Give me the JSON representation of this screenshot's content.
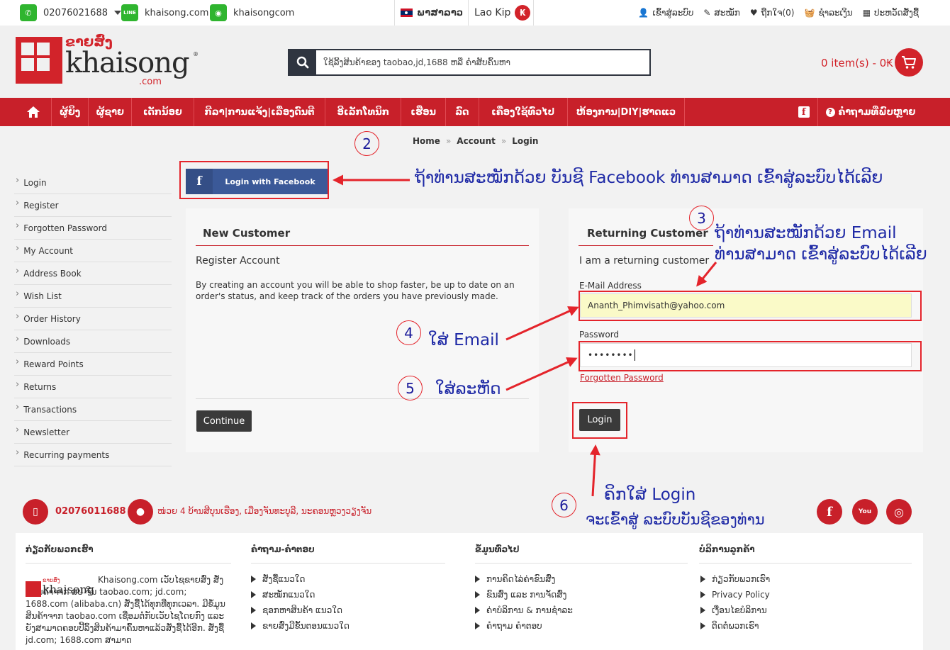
{
  "topbar": {
    "phone": "02076021688",
    "line_label": "LINE",
    "line_site": "khaisong.com",
    "wechat_site": "khaisongcom",
    "language": "ພາສາລາວ",
    "currency": "Lao Kip",
    "currency_symbol": "₭",
    "links": [
      "ເຂົ້າສູ່ລະບົບ",
      "ສະໝັກ",
      "ຖືກໃຈ(0)",
      "ຊຳລະເງິນ",
      "ປະຫວັດສັ່ງຊື້"
    ]
  },
  "header": {
    "logo_lao": "ຂາຍສົ່ງ",
    "logo_main": "khaisong",
    "logo_com": ".com",
    "logo_reg": "®",
    "search_placeholder": "ໃຊ້ລີ້ງສິນຄ້າຂອງ taobao,jd,1688 ຫລື ຄຳສັບຄົ້ນຫາ",
    "cart_text": "0 item(s) - 0₭"
  },
  "nav": {
    "items": [
      "ຜູ້ຍິງ",
      "ຜູ້ຊາຍ",
      "ເດັກນ້ອຍ",
      "ກີລາ|ການແຈ້ງ|ເລື່ອງດົນຕີ",
      "ອີເລັກໂທນິກ",
      "ເຮືອນ",
      "ລົດ",
      "ເຄື່ອງໃຊ້ທົ່ວໄປ",
      "ຫ້ອງການ|DIY|ຮາດແວ"
    ],
    "faq": "ຄຳຖາມທີ່ພົບຫຼາຍ"
  },
  "breadcrumb": [
    "Home",
    "Account",
    "Login"
  ],
  "sidebar": {
    "items": [
      "Login",
      "Register",
      "Forgotten Password",
      "My Account",
      "Address Book",
      "Wish List",
      "Order History",
      "Downloads",
      "Reward Points",
      "Returns",
      "Transactions",
      "Newsletter",
      "Recurring payments"
    ]
  },
  "facebook_login": {
    "letter": "f",
    "label": "Login with Facebook"
  },
  "new_customer": {
    "title": "New Customer",
    "subtitle": "Register Account",
    "desc": "By creating an account you will be able to shop faster, be up to date on an order's status, and keep track of the orders you have previously made.",
    "button": "Continue"
  },
  "returning_customer": {
    "title": "Returning Customer",
    "subtitle": "I am a returning customer",
    "email_label": "E-Mail Address",
    "email_value": "Ananth_Phimvisath@yahoo.com",
    "password_label": "Password",
    "password_value": "••••••••",
    "forgot": "Forgotten Password",
    "button": "Login"
  },
  "annotations": {
    "n2": "2",
    "n3": "3",
    "n4": "4",
    "n5": "5",
    "n6": "6",
    "fb_note": "ຖ້າທ່ານສະໝັກດ້ວຍ ບັນຊີ Facebook ທ່ານສາມາດ ເຂົ້າສູ່ລະບົບໄດ້ເລີຍ",
    "email_note_1": "ຖ້າທ່ານສະໝັກດ້ວຍ Email",
    "email_note_2": "ທ່ານສາມາດ ເຂົ້າສູ່ລະບົບໄດ້ເລີຍ",
    "email_step": "ໃສ່ Email",
    "pass_step": "ໃສ່ລະຫັດ",
    "login_step_1": "ຄິກໃສ່ Login",
    "login_step_2": "ຈະເຂົ້າສູ່ ລະບົບບັນຊີຂອງທ່ານ"
  },
  "footer": {
    "phone": "02076011688",
    "address": "ໜ່ວຍ 4 ບ້ານສີບຸນເຮືອງ, ເມືອງຈັນທະບູລີ, ນະຄອນຫຼວງວຽງຈັນ",
    "social": [
      "f",
      "You",
      "◎"
    ],
    "col1_title": "ກ່ຽວກັບພວກເຮົາ",
    "about": "Khaisong.com ເວັບໄຊຂາຍສົ່ງ ສັ່ງຊື້ສິນຄ້າຈາກ ສປ ຈີນ taobao.com; jd.com; 1688.com (alibaba.cn) ສັ່ງຊື້ໄດ້ທຸກທີ່ທຸກເວລາ. ມີຂໍ້ມູນສິນຄ້າຈາກ taobao.com ເຊື່ອມຕໍ່ກັບເວັບໄຊໂດຍກົງ ແລະ ຍັງສາມາດຄອບປີ້ລິ້ງສິນຄ້າມາຄົ້ນຫາແລ້ວສັ່ງຊື້ໄດ້ອີກ. ສັ່ງຊື້ jd.com; 1688.com ສາມາດ",
    "col2_title": "ຄຳຖາມ-ຄຳຕອບ",
    "col2_links": [
      "ສັ່ງຊື້ແນວໃດ",
      "ສະໝັກແນວໃດ",
      "ຊອກຫາສິນຄ້າ ແນວໃດ",
      "ຂາຍສົ່ງມີຂັ້ນຕອນແນວໃດ"
    ],
    "col3_title": "ຂໍ້ມູນທົ່ວໄປ",
    "col3_links": [
      "ການຄິດໄລ່ຄ່າຂົນສົ່ງ",
      "ຂົນສົ່ງ ແລະ ການຈັດສົ່ງ",
      "ຄ່າບໍລິການ & ການຊຳລະ",
      "ຄຳຖາມ ຄຳຕອບ"
    ],
    "col4_title": "ບໍລິການລູກຄ້າ",
    "col4_links": [
      "ກ່ຽວກັບພວກເຮົາ",
      "Privacy Policy",
      "ເງື່ອນໄຂບໍລິການ",
      "ຕິດຕໍ່ພວກເຮົາ"
    ]
  }
}
